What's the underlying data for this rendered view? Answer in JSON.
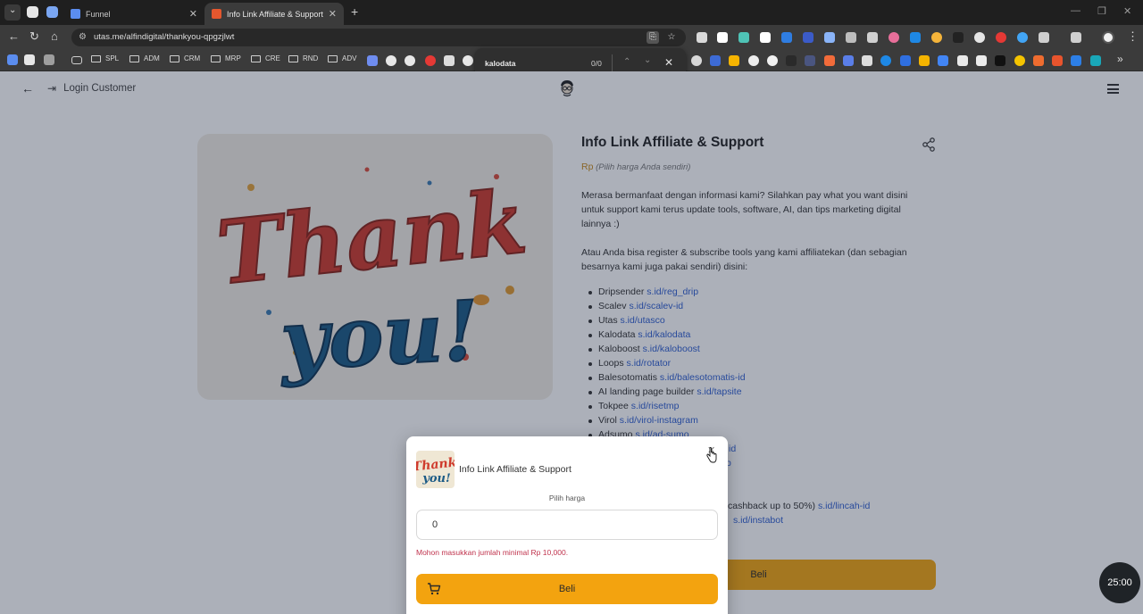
{
  "browser": {
    "tabs": [
      {
        "title": "Funnel",
        "close": "✕"
      },
      {
        "title": "Info Link Affiliate & Support by",
        "close": "✕"
      }
    ],
    "new_tab": "+",
    "url": "utas.me/alfindigital/thankyou-qpgzjlwt",
    "bookmark_folders": [
      "SPL",
      "ADM",
      "CRM",
      "MRP",
      "CRE",
      "RND",
      "ADV"
    ],
    "more_bookmarks": "»",
    "find": {
      "query": "kalodata",
      "count": "0/0"
    }
  },
  "page": {
    "login_label": "Login Customer",
    "product": {
      "title": "Info Link Affiliate & Support",
      "price_currency": "Rp",
      "price_note": "(Pilih harga Anda sendiri)",
      "description": [
        "Merasa bermanfaat dengan informasi kami? Silahkan pay what you want disini untuk support kami terus update tools, software, AI, dan tips marketing digital lainnya :)",
        "Atau Anda bisa register & subscribe tools yang kami affiliatekan (dan sebagian besarnya kami juga pakai sendiri) disini:"
      ],
      "links": [
        {
          "name": "Dripsender",
          "url": "s.id/reg_drip"
        },
        {
          "name": "Scalev",
          "url": "s.id/scalev-id"
        },
        {
          "name": "Utas",
          "url": "s.id/utasco"
        },
        {
          "name": "Kalodata",
          "url": "s.id/kalodata"
        },
        {
          "name": "Kaloboost",
          "url": "s.id/kaloboost"
        },
        {
          "name": "Loops",
          "url": "s.id/rotator"
        },
        {
          "name": "Balesotomatis",
          "url": "s.id/balesotomatis-id"
        },
        {
          "name": "AI landing page builder",
          "url": "s.id/tapsite"
        },
        {
          "name": "Tokpee",
          "url": "s.id/risetmp"
        },
        {
          "name": "Virol",
          "url": "s.id/virol-instagram"
        },
        {
          "name": "Adsumo",
          "url": "s.id/ad-sumo"
        }
      ],
      "partial_lines": [
        {
          "text": "",
          "url": "id"
        },
        {
          "text": "",
          "url": "p"
        },
        {
          "text": "cashback up to 50%)",
          "url": "s.id/lincah-id"
        },
        {
          "text": "",
          "url": "s.id/instabot"
        }
      ],
      "buy_label": "Beli"
    },
    "hero_text": {
      "line1": "Thank",
      "line2": "you!"
    }
  },
  "modal": {
    "title": "Info Link Affiliate & Support",
    "close": "✕",
    "price_label": "Pilih harga",
    "price_value": "0",
    "error": "Mohon masukkan jumlah minimal Rp 10,000.",
    "buy_label": "Beli",
    "thumb_text": {
      "line1": "Thank",
      "line2": "you!"
    }
  },
  "timer": "25:00",
  "colors": {
    "accent": "#f3a30f",
    "link": "#2f5fd0",
    "error": "#c0334d",
    "thank_red": "#cf3b2d",
    "you_blue": "#1c5b86"
  }
}
